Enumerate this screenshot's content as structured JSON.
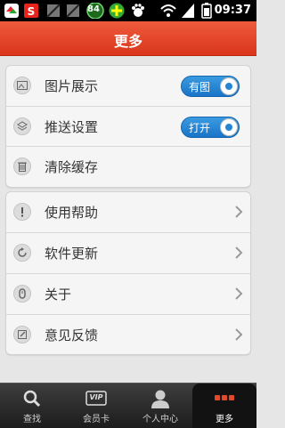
{
  "status_bar": {
    "time": "09:37",
    "badge_number": "84",
    "icons": [
      "app-icon",
      "sohu-icon",
      "image-icon",
      "image-icon",
      "battery-saver-icon",
      "plus-icon",
      "baidu-icon",
      "wifi-icon",
      "signal-icon",
      "battery-icon"
    ]
  },
  "header": {
    "title": "更多"
  },
  "settings_group": {
    "items": [
      {
        "label": "图片展示",
        "icon": "image-icon",
        "toggle_text": "有图",
        "toggle_on": true
      },
      {
        "label": "推送设置",
        "icon": "push-icon",
        "toggle_text": "打开",
        "toggle_on": true
      },
      {
        "label": "清除缓存",
        "icon": "trash-icon"
      }
    ]
  },
  "info_group": {
    "items": [
      {
        "label": "使用帮助",
        "icon": "help-icon"
      },
      {
        "label": "软件更新",
        "icon": "refresh-icon"
      },
      {
        "label": "关于",
        "icon": "info-icon"
      },
      {
        "label": "意见反馈",
        "icon": "feedback-icon"
      }
    ]
  },
  "bottom_nav": {
    "items": [
      {
        "label": "查找",
        "icon": "search-icon"
      },
      {
        "label": "会员卡",
        "icon": "vip-card-icon",
        "icon_text": "VIP"
      },
      {
        "label": "个人中心",
        "icon": "person-icon"
      },
      {
        "label": "更多",
        "icon": "more-icon",
        "active": true
      }
    ]
  },
  "colors": {
    "accent": "#e24a2c",
    "toggle": "#1f7fd0",
    "nav_bg": "#2a2a2a"
  }
}
